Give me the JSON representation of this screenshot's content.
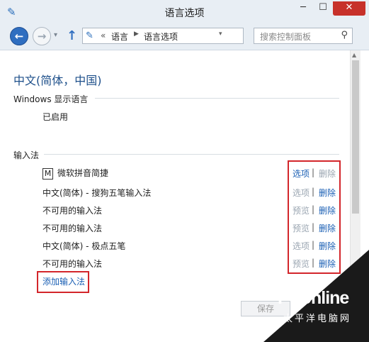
{
  "window": {
    "title": "语言选项"
  },
  "titlebar": {
    "minimize": "─",
    "maximize": "☐",
    "close": "✕"
  },
  "nav": {
    "breadcrumb": [
      "语言",
      "语言选项"
    ],
    "search_placeholder": "搜索控制面板"
  },
  "page": {
    "title": "中文(简体，中国)"
  },
  "display_language": {
    "heading": "Windows 显示语言",
    "status": "已启用"
  },
  "input_methods": {
    "heading": "输入法",
    "items": [
      {
        "name": "微软拼音简捷",
        "option": "选项",
        "delete": "删除"
      },
      {
        "name": "中文(简体) - 搜狗五笔输入法",
        "option": "选项",
        "delete": "删除"
      },
      {
        "name": "不可用的输入法",
        "option": "预览",
        "delete": "删除"
      },
      {
        "name": "不可用的输入法",
        "option": "预览",
        "delete": "删除"
      },
      {
        "name": "中文(简体) - 极点五笔",
        "option": "选项",
        "delete": "删除"
      },
      {
        "name": "不可用的输入法",
        "option": "预览",
        "delete": "删除"
      }
    ],
    "add_link": "添加输入法"
  },
  "footer": {
    "save": "保存"
  },
  "watermark": {
    "brand": "PConline",
    "tagline": "太平洋电脑网"
  },
  "colors": {
    "link": "#1a5fb4",
    "highlight": "#d3262b",
    "title": "#1d4f8a",
    "close": "#c7312a"
  }
}
